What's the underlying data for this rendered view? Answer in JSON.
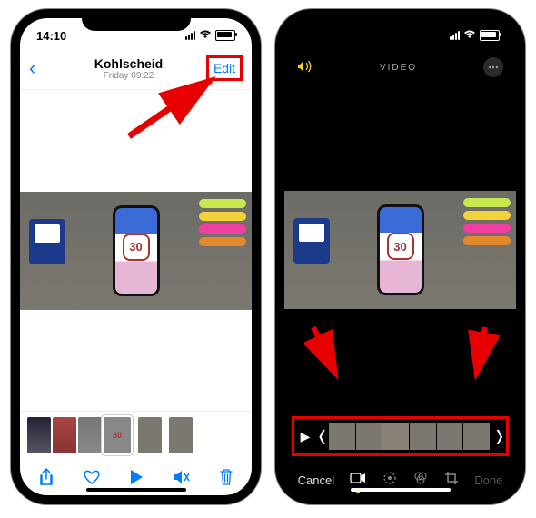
{
  "screen1": {
    "status_time": "14:10",
    "title": "Kohlscheid",
    "subtitle": "Friday  09:22",
    "edit_label": "Edit",
    "badge_text": "30",
    "thumb4_text": "30"
  },
  "screen2": {
    "header_label": "VIDEO",
    "badge_text": "30",
    "cancel_label": "Cancel",
    "done_label": "Done"
  }
}
